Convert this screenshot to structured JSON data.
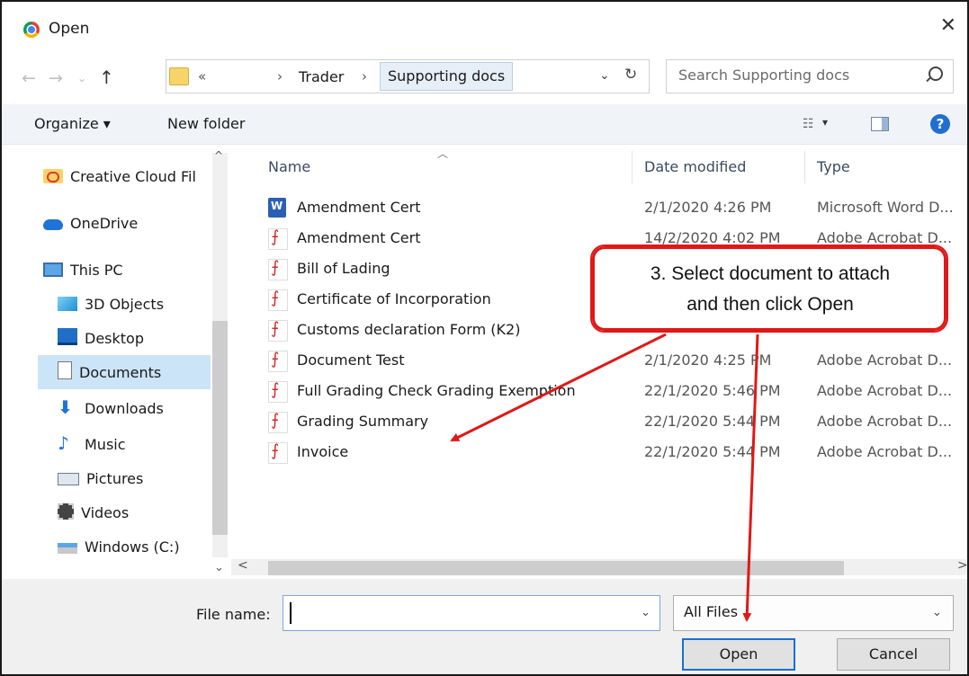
{
  "window": {
    "title": "Open",
    "close_symbol": "✕"
  },
  "address": {
    "overflow": "«",
    "sep": "›",
    "crumbs": [
      "Trader",
      "Supporting docs"
    ],
    "dropdown": "⌄",
    "refresh": "↻",
    "search_placeholder": "Search Supporting docs"
  },
  "toolbar": {
    "organize": "Organize ▾",
    "new_folder": "New folder",
    "view_dd": "▾",
    "help": "?"
  },
  "nav": {
    "items": [
      {
        "label": "Creative Cloud Fil"
      },
      {
        "label": "OneDrive"
      },
      {
        "label": "This PC"
      },
      {
        "label": "3D Objects"
      },
      {
        "label": "Desktop"
      },
      {
        "label": "Documents"
      },
      {
        "label": "Downloads"
      },
      {
        "label": "Music"
      },
      {
        "label": "Pictures"
      },
      {
        "label": "Videos"
      },
      {
        "label": "Windows (C:)"
      }
    ],
    "selected": "Documents"
  },
  "columns": {
    "name": "Name",
    "date": "Date modified",
    "type": "Type"
  },
  "files": [
    {
      "icon": "word-icon",
      "name": "Amendment Cert",
      "date": "2/1/2020 4:26 PM",
      "type": "Microsoft Word D..."
    },
    {
      "icon": "pdf-icon",
      "name": "Amendment Cert",
      "date": "14/2/2020 4:02 PM",
      "type": "Adobe Acrobat D..."
    },
    {
      "icon": "pdf-icon",
      "name": "Bill of Lading",
      "date": "",
      "type": ""
    },
    {
      "icon": "pdf-icon",
      "name": "Certificate of Incorporation",
      "date": "",
      "type": ""
    },
    {
      "icon": "pdf-icon",
      "name": "Customs declaration Form (K2)",
      "date": "",
      "type": ""
    },
    {
      "icon": "pdf-icon",
      "name": "Document Test",
      "date": "2/1/2020 4:25 PM",
      "type": "Adobe Acrobat D..."
    },
    {
      "icon": "pdf-icon",
      "name": "Full Grading Check Grading Exemption",
      "date": "22/1/2020 5:46 PM",
      "type": "Adobe Acrobat D..."
    },
    {
      "icon": "pdf-icon",
      "name": "Grading Summary",
      "date": "22/1/2020 5:44 PM",
      "type": "Adobe Acrobat D..."
    },
    {
      "icon": "pdf-icon",
      "name": "Invoice",
      "date": "22/1/2020 5:44 PM",
      "type": "Adobe Acrobat D..."
    }
  ],
  "bottom": {
    "file_name_label": "File name:",
    "file_name_value": "",
    "file_type": "All Files",
    "open": "Open",
    "cancel": "Cancel"
  },
  "callout": {
    "line1": "3. Select document to attach",
    "line2": "and then click Open"
  },
  "colors": {
    "callout": "#e01818",
    "selection": "#cce4f7",
    "accent": "#1a6fd1"
  }
}
